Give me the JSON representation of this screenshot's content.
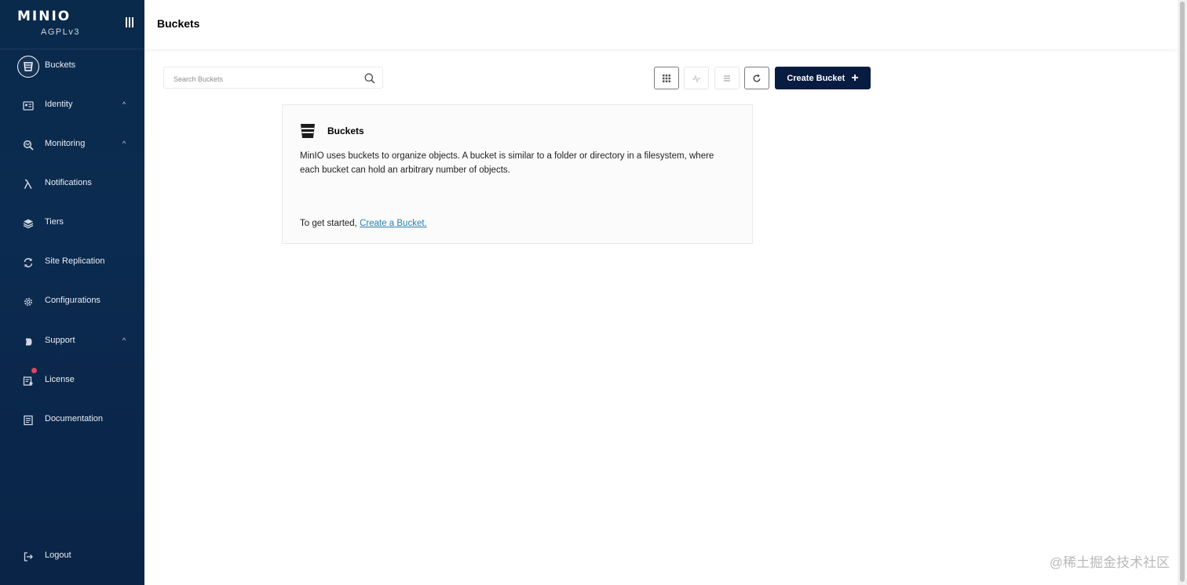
{
  "brand": {
    "logo": "MINIO",
    "license": "AGPLv3"
  },
  "sidebar": {
    "items": [
      {
        "label": "Buckets",
        "icon": "bucket-icon",
        "active": true
      },
      {
        "label": "Identity",
        "icon": "identity-icon",
        "chevron": "^"
      },
      {
        "label": "Monitoring",
        "icon": "monitoring-icon",
        "chevron": "^"
      },
      {
        "label": "Notifications",
        "icon": "lambda-icon"
      },
      {
        "label": "Tiers",
        "icon": "tiers-icon"
      },
      {
        "label": "Site Replication",
        "icon": "replication-icon"
      },
      {
        "label": "Configurations",
        "icon": "gear-icon"
      },
      {
        "label": "Support",
        "icon": "support-icon",
        "chevron": "^"
      },
      {
        "label": "License",
        "icon": "license-icon",
        "badge_color": "#e0475a"
      },
      {
        "label": "Documentation",
        "icon": "documentation-icon"
      }
    ],
    "logout": "Logout"
  },
  "header": {
    "title": "Buckets"
  },
  "search": {
    "placeholder": "Search Buckets"
  },
  "toolbar": {
    "create_label": "Create Bucket",
    "create_plus": "+"
  },
  "card": {
    "title": "Buckets",
    "description": "MinIO uses buckets to organize objects. A bucket is similar to a folder or directory in a filesystem, where each bucket can hold an arbitrary number of objects.",
    "cta_prefix": "To get started, ",
    "cta_link": "Create a Bucket."
  },
  "watermark": "@稀土掘金技术社区",
  "colors": {
    "sidebar": "#0b2b50",
    "primary_button": "#081c42",
    "link": "#2781b0",
    "badge": "#e0475a"
  }
}
